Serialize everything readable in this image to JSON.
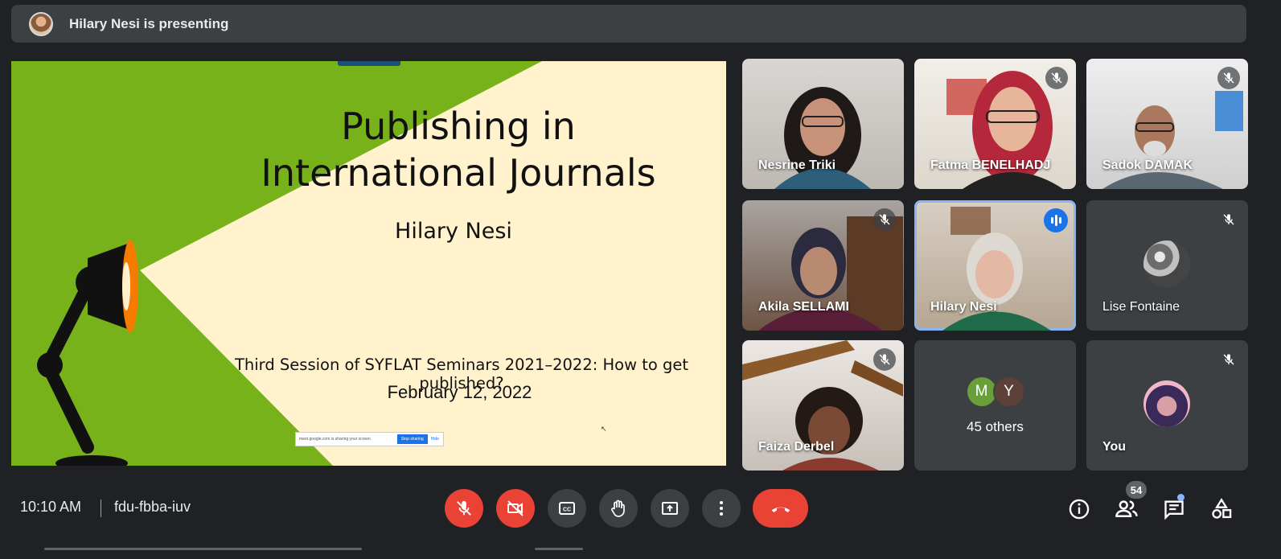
{
  "banner": {
    "text": "Hilary Nesi is presenting"
  },
  "slide": {
    "title_line1": "Publishing in",
    "title_line2": "International Journals",
    "author": "Hilary Nesi",
    "session": "Third Session of SYFLAT Seminars 2021–2022: How to get published?",
    "date": "February 12, 2022",
    "share_notice": "meet.google.com is sharing your screen.",
    "stop_sharing": "Stop sharing",
    "hide": "Hide"
  },
  "participants": [
    {
      "name": "Nesrine Triki",
      "muted": false
    },
    {
      "name": "Fatma BENELHADJ",
      "muted": true
    },
    {
      "name": "Sadok DAMAK",
      "muted": true
    },
    {
      "name": "Akila SELLAMI",
      "muted": true
    },
    {
      "name": "Hilary Nesi",
      "muted": false,
      "speaking": true
    },
    {
      "name": "Lise Fontaine",
      "muted": true
    },
    {
      "name": "Faiza Derbel",
      "muted": true
    },
    {
      "others_label": "45 others",
      "initials": [
        "M",
        "Y"
      ],
      "colors": [
        "#689f38",
        "#5d4037"
      ]
    },
    {
      "name": "You",
      "muted": true
    }
  ],
  "bottom": {
    "time": "10:10 AM",
    "meeting_code": "fdu-fbba-iuv",
    "participant_count": "54"
  },
  "colors": {
    "background": "#202124",
    "tile": "#3c4043",
    "danger": "#ea4335",
    "accent": "#8ab4f8"
  },
  "icons": [
    "mic-off-icon",
    "camera-off-icon",
    "captions-icon",
    "raise-hand-icon",
    "present-icon",
    "more-icon",
    "hangup-icon",
    "info-icon",
    "people-icon",
    "chat-icon",
    "activities-icon"
  ]
}
